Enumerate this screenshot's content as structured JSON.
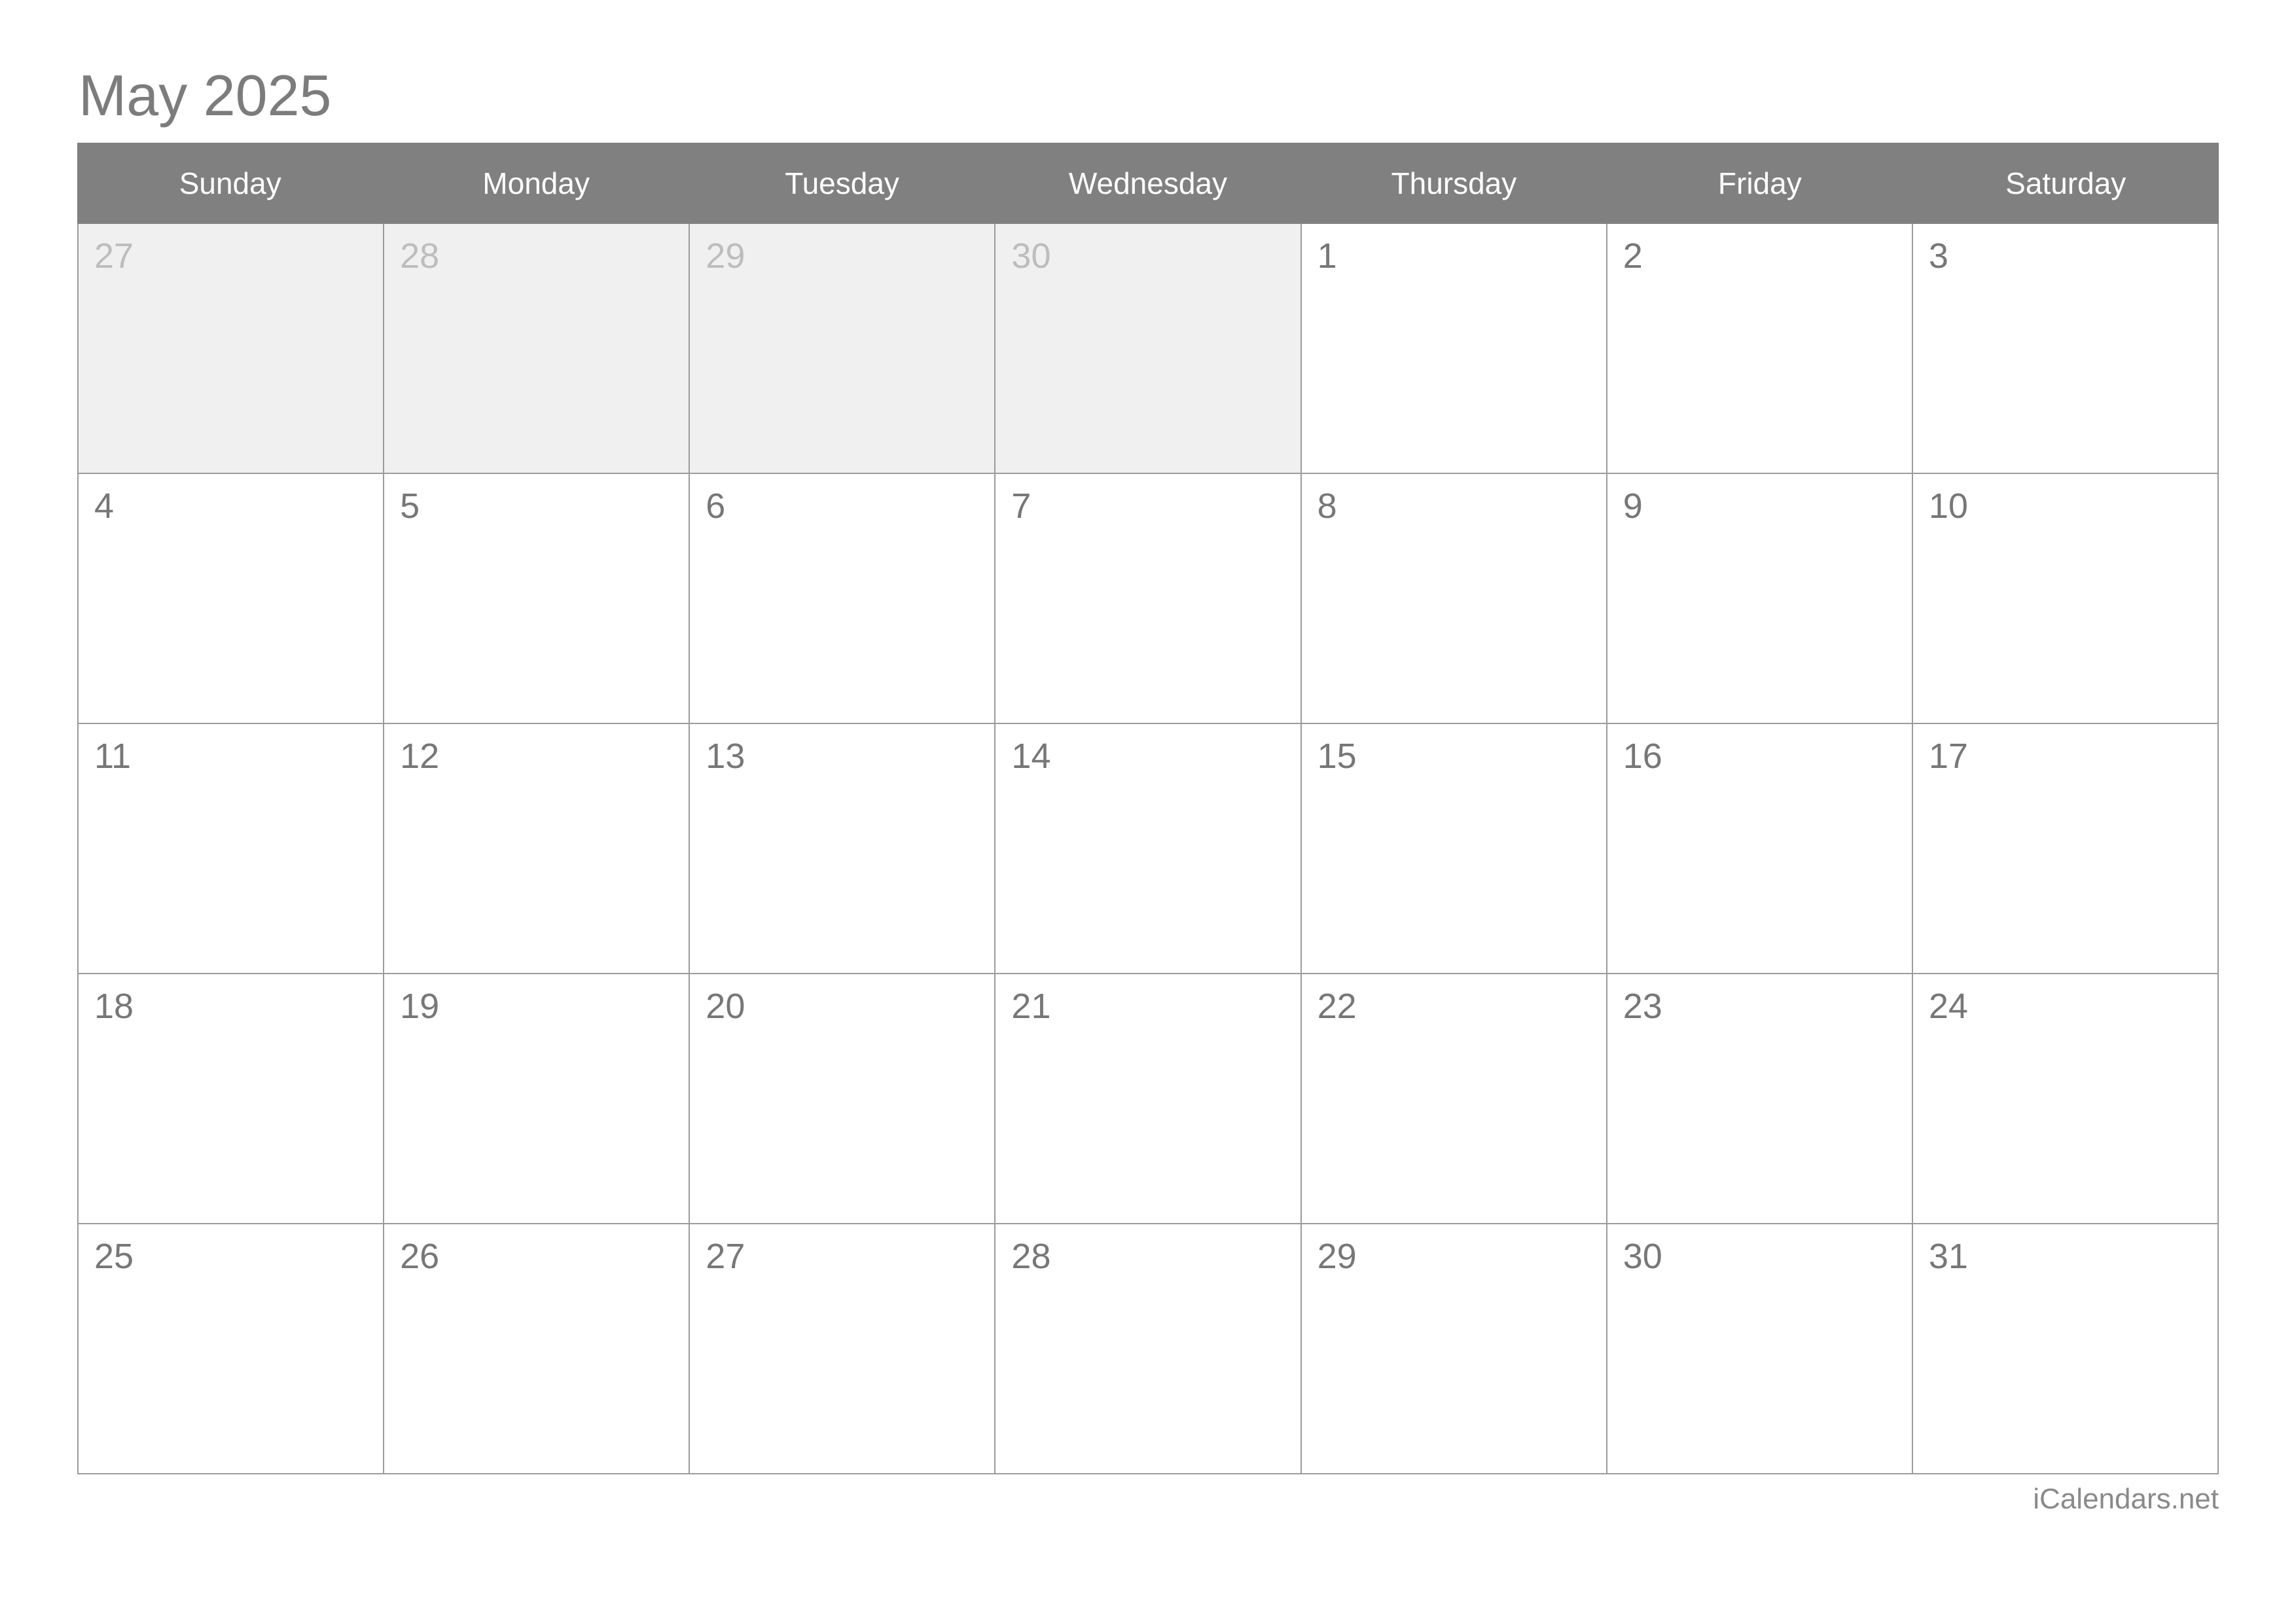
{
  "title": "May 2025",
  "month": "May",
  "year": "2025",
  "colors": {
    "header_bg": "#808080",
    "header_text": "#ffffff",
    "grid_border": "#9b9b9b",
    "in_month_bg": "#ffffff",
    "in_month_text": "#777777",
    "out_month_bg": "#f0f0f0",
    "out_month_text": "#bdbdbd",
    "title_text": "#7c7c7c",
    "footer_text": "#8a8a8a"
  },
  "weekday_headers": [
    "Sunday",
    "Monday",
    "Tuesday",
    "Wednesday",
    "Thursday",
    "Friday",
    "Saturday"
  ],
  "weeks": [
    [
      {
        "day": "27",
        "in_month": false
      },
      {
        "day": "28",
        "in_month": false
      },
      {
        "day": "29",
        "in_month": false
      },
      {
        "day": "30",
        "in_month": false
      },
      {
        "day": "1",
        "in_month": true
      },
      {
        "day": "2",
        "in_month": true
      },
      {
        "day": "3",
        "in_month": true
      }
    ],
    [
      {
        "day": "4",
        "in_month": true
      },
      {
        "day": "5",
        "in_month": true
      },
      {
        "day": "6",
        "in_month": true
      },
      {
        "day": "7",
        "in_month": true
      },
      {
        "day": "8",
        "in_month": true
      },
      {
        "day": "9",
        "in_month": true
      },
      {
        "day": "10",
        "in_month": true
      }
    ],
    [
      {
        "day": "11",
        "in_month": true
      },
      {
        "day": "12",
        "in_month": true
      },
      {
        "day": "13",
        "in_month": true
      },
      {
        "day": "14",
        "in_month": true
      },
      {
        "day": "15",
        "in_month": true
      },
      {
        "day": "16",
        "in_month": true
      },
      {
        "day": "17",
        "in_month": true
      }
    ],
    [
      {
        "day": "18",
        "in_month": true
      },
      {
        "day": "19",
        "in_month": true
      },
      {
        "day": "20",
        "in_month": true
      },
      {
        "day": "21",
        "in_month": true
      },
      {
        "day": "22",
        "in_month": true
      },
      {
        "day": "23",
        "in_month": true
      },
      {
        "day": "24",
        "in_month": true
      }
    ],
    [
      {
        "day": "25",
        "in_month": true
      },
      {
        "day": "26",
        "in_month": true
      },
      {
        "day": "27",
        "in_month": true
      },
      {
        "day": "28",
        "in_month": true
      },
      {
        "day": "29",
        "in_month": true
      },
      {
        "day": "30",
        "in_month": true
      },
      {
        "day": "31",
        "in_month": true
      }
    ]
  ],
  "footer": {
    "attribution": "iCalendars.net"
  }
}
